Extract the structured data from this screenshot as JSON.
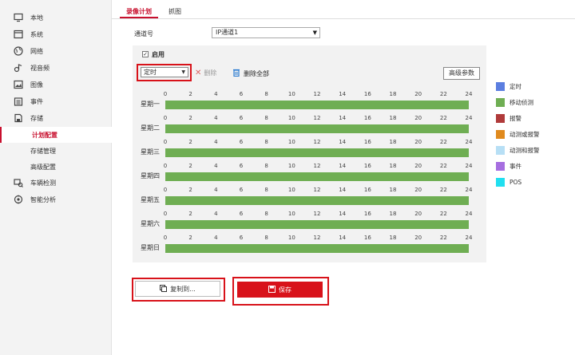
{
  "sidebar": {
    "items": [
      {
        "label": "本地",
        "icon": "monitor-icon"
      },
      {
        "label": "系统",
        "icon": "window-icon"
      },
      {
        "label": "网络",
        "icon": "globe-icon"
      },
      {
        "label": "视音频",
        "icon": "audio-video-icon"
      },
      {
        "label": "图像",
        "icon": "image-icon"
      },
      {
        "label": "事件",
        "icon": "calendar-icon"
      },
      {
        "label": "存储",
        "icon": "storage-icon"
      },
      {
        "label": "计划配置",
        "icon": "",
        "active": true
      },
      {
        "label": "存储管理",
        "icon": ""
      },
      {
        "label": "高级配置",
        "icon": ""
      },
      {
        "label": "车辆检测",
        "icon": "vehicle-icon"
      },
      {
        "label": "智能分析",
        "icon": "smart-analysis-icon"
      }
    ]
  },
  "tabs": [
    {
      "label": "录像计划",
      "active": true
    },
    {
      "label": "抓图",
      "active": false
    }
  ],
  "channel": {
    "label": "通道号",
    "value": "IP通道1"
  },
  "enable": {
    "label": "启用",
    "checked": true
  },
  "toolbar": {
    "type_value": "定时",
    "delete_label": "删除",
    "delete_all_label": "删除全部",
    "advanced_label": "高级参数"
  },
  "schedule": {
    "hour_ticks": [
      "0",
      "2",
      "4",
      "6",
      "8",
      "10",
      "12",
      "14",
      "16",
      "18",
      "20",
      "22",
      "24"
    ],
    "days": [
      {
        "label": "星期一",
        "start": 0,
        "end": 24,
        "type": "移动侦测"
      },
      {
        "label": "星期二",
        "start": 0,
        "end": 24,
        "type": "移动侦测"
      },
      {
        "label": "星期三",
        "start": 0,
        "end": 24,
        "type": "移动侦测"
      },
      {
        "label": "星期四",
        "start": 0,
        "end": 24,
        "type": "移动侦测"
      },
      {
        "label": "星期五",
        "start": 0,
        "end": 24,
        "type": "移动侦测"
      },
      {
        "label": "星期六",
        "start": 0,
        "end": 24,
        "type": "移动侦测"
      },
      {
        "label": "星期日",
        "start": 0,
        "end": 24,
        "type": "移动侦测"
      }
    ]
  },
  "legend": [
    {
      "label": "定时",
      "color": "#5b7ee0"
    },
    {
      "label": "移动侦测",
      "color": "#6fae53"
    },
    {
      "label": "报警",
      "color": "#b03a3a"
    },
    {
      "label": "动测或报警",
      "color": "#e08a1e"
    },
    {
      "label": "动测和报警",
      "color": "#b7dff5"
    },
    {
      "label": "事件",
      "color": "#a66ee0"
    },
    {
      "label": "POS",
      "color": "#20dff0"
    }
  ],
  "buttons": {
    "copy_label": "复制到...",
    "save_label": "保存"
  }
}
